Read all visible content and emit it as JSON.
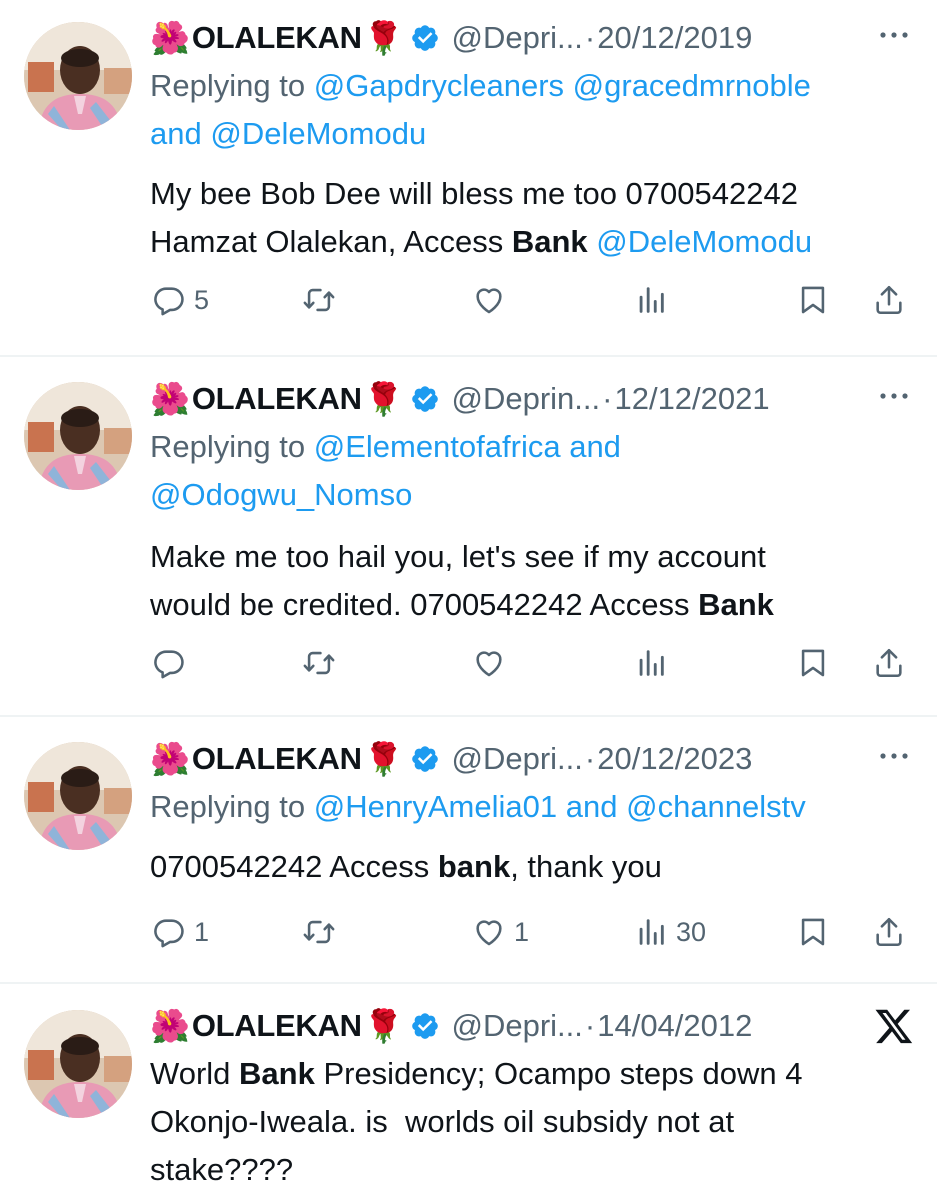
{
  "tweets": [
    {
      "name": "OLALEKAN",
      "handle": "@Depri...",
      "date": "20/12/2019",
      "reply_prefix": "Replying to ",
      "reply_mentions": [
        "@Gapdrycleaners",
        "@gracedmrnoble"
      ],
      "reply_and": "and",
      "reply_last": "@DeleMomodu",
      "text_line1": "My bee Bob Dee will bless me too 0700542242",
      "text_line2_pre": "Hamzat Olalekan, Access ",
      "text_bold": "Bank",
      "text_mention": "@DeleMomodu",
      "replies": "5",
      "likes": "",
      "views": ""
    },
    {
      "name": "OLALEKAN",
      "handle": "@Deprin...",
      "date": "12/12/2021",
      "reply_prefix": "Replying to ",
      "reply_first": "@Elementofafrica",
      "reply_and": "and",
      "reply_last": "@Odogwu_Nomso",
      "text_line1": "Make me too hail you, let's see if my account",
      "text_line2_pre": "would be credited. 0700542242 Access ",
      "text_bold": "Bank",
      "replies": "",
      "likes": "",
      "views": ""
    },
    {
      "name": "OLALEKAN",
      "handle": "@Depri...",
      "date": "20/12/2023",
      "reply_prefix": "Replying to ",
      "reply_first": "@HenryAmelia01",
      "reply_and": "and",
      "reply_last": "@channelstv",
      "text_pre": "0700542242 Access ",
      "text_bold": "bank",
      "text_post": ", thank you",
      "replies": "1",
      "likes": "1",
      "views": "30"
    },
    {
      "name": "OLALEKAN",
      "handle": "@Depri...",
      "date": "14/04/2012",
      "text_line1_pre": "World ",
      "text_bold": "Bank",
      "text_line1_post": " Presidency; Ocampo steps down 4",
      "text_line2": "Okonjo-Iweala. is  worlds oil subsidy not at",
      "text_line3": "stake????"
    }
  ],
  "separator": "·",
  "icons": {
    "flower": "hibiscus-emoji",
    "rose": "rose-emoji",
    "verified": "verified-badge-icon",
    "more": "more-icon",
    "reply": "reply-icon",
    "retweet": "retweet-icon",
    "like": "heart-icon",
    "views": "views-icon",
    "bookmark": "bookmark-icon",
    "share": "share-icon",
    "x": "x-logo-icon"
  },
  "colors": {
    "text": "#0f1419",
    "secondary": "#536471",
    "link": "#1d9bf0",
    "verified": "#1d9bf0",
    "divider": "#eff3f4"
  }
}
